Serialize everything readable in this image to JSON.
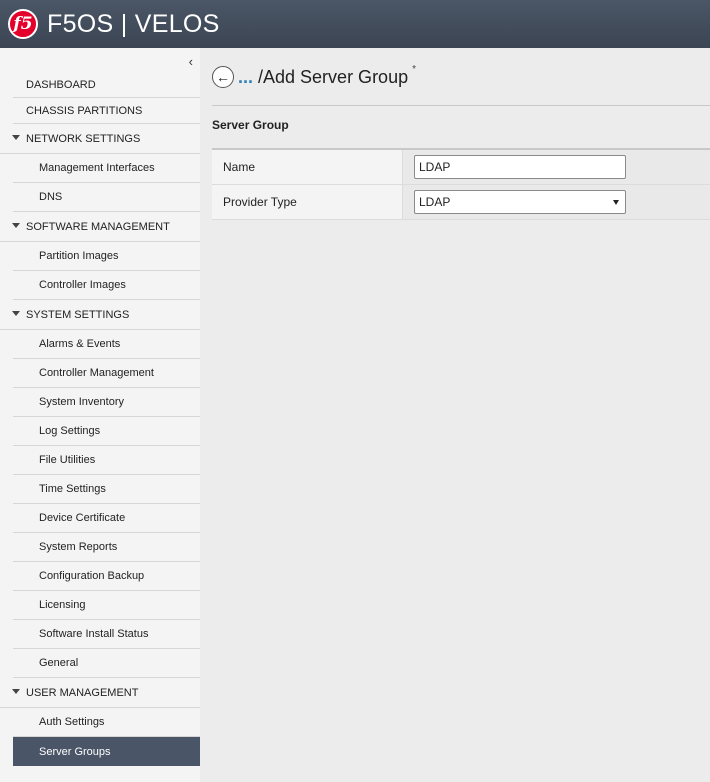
{
  "header": {
    "logo_text": "f5",
    "title": "F5OS | VELOS"
  },
  "sidebar": {
    "collapse_glyph": "‹",
    "items": [
      {
        "label": "DASHBOARD",
        "kind": "top"
      },
      {
        "label": "CHASSIS PARTITIONS",
        "kind": "top"
      },
      {
        "label": "NETWORK SETTINGS",
        "kind": "section"
      },
      {
        "label": "Management Interfaces",
        "kind": "child"
      },
      {
        "label": "DNS",
        "kind": "child"
      },
      {
        "label": "SOFTWARE MANAGEMENT",
        "kind": "section"
      },
      {
        "label": "Partition Images",
        "kind": "child"
      },
      {
        "label": "Controller Images",
        "kind": "child"
      },
      {
        "label": "SYSTEM SETTINGS",
        "kind": "section"
      },
      {
        "label": "Alarms & Events",
        "kind": "child"
      },
      {
        "label": "Controller Management",
        "kind": "child"
      },
      {
        "label": "System Inventory",
        "kind": "child"
      },
      {
        "label": "Log Settings",
        "kind": "child"
      },
      {
        "label": "File Utilities",
        "kind": "child"
      },
      {
        "label": "Time Settings",
        "kind": "child"
      },
      {
        "label": "Device Certificate",
        "kind": "child"
      },
      {
        "label": "System Reports",
        "kind": "child"
      },
      {
        "label": "Configuration Backup",
        "kind": "child"
      },
      {
        "label": "Licensing",
        "kind": "child"
      },
      {
        "label": "Software Install Status",
        "kind": "child"
      },
      {
        "label": "General",
        "kind": "child"
      },
      {
        "label": "USER MANAGEMENT",
        "kind": "section"
      },
      {
        "label": "Auth Settings",
        "kind": "child"
      },
      {
        "label": "Server Groups",
        "kind": "child",
        "active": true
      }
    ]
  },
  "main": {
    "back_icon": "back-arrow-icon",
    "breadcrumb_dots": "...",
    "title": "/Add Server Group",
    "required_marker": "*",
    "section_title": "Server Group",
    "form": {
      "name_label": "Name",
      "name_value": "LDAP",
      "provider_type_label": "Provider Type",
      "provider_type_value": "LDAP"
    }
  },
  "colors": {
    "header": "#434d5c",
    "active_nav": "#4a5567",
    "logo": "#e4002b",
    "link": "#2f7fb8"
  }
}
